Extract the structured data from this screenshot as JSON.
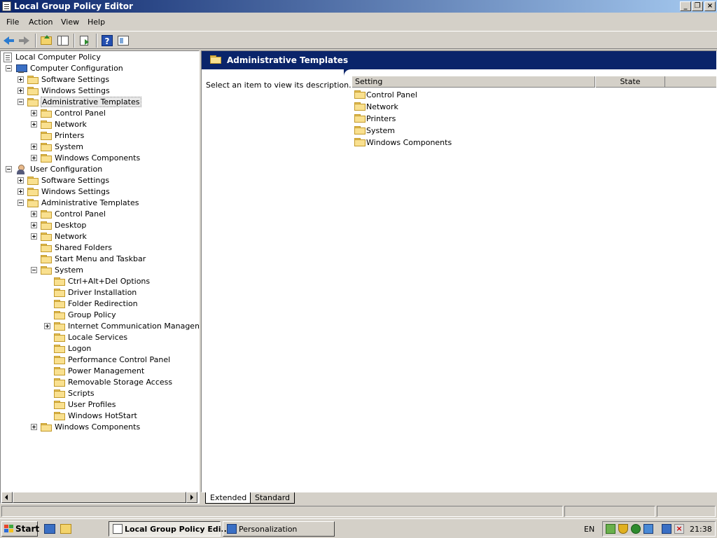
{
  "window": {
    "title": "Local Group Policy Editor"
  },
  "menu": [
    "File",
    "Action",
    "View",
    "Help"
  ],
  "tree": [
    {
      "label": "Local Computer Policy",
      "level": 0,
      "icon": "document-icon",
      "expander": "none"
    },
    {
      "label": "Computer Configuration",
      "level": 0,
      "icon": "computer-icon",
      "expander": "minus"
    },
    {
      "label": "Software Settings",
      "level": 1,
      "icon": "folder-icon",
      "expander": "plus"
    },
    {
      "label": "Windows Settings",
      "level": 1,
      "icon": "folder-icon",
      "expander": "plus"
    },
    {
      "label": "Administrative Templates",
      "level": 1,
      "icon": "folder-icon",
      "expander": "minus",
      "selected": true
    },
    {
      "label": "Control Panel",
      "level": 2,
      "icon": "folder-icon",
      "expander": "plus"
    },
    {
      "label": "Network",
      "level": 2,
      "icon": "folder-icon",
      "expander": "plus"
    },
    {
      "label": "Printers",
      "level": 2,
      "icon": "folder-icon",
      "expander": "none"
    },
    {
      "label": "System",
      "level": 2,
      "icon": "folder-icon",
      "expander": "plus"
    },
    {
      "label": "Windows Components",
      "level": 2,
      "icon": "folder-icon",
      "expander": "plus"
    },
    {
      "label": "User Configuration",
      "level": 0,
      "icon": "user-icon",
      "expander": "minus"
    },
    {
      "label": "Software Settings",
      "level": 1,
      "icon": "folder-icon",
      "expander": "plus"
    },
    {
      "label": "Windows Settings",
      "level": 1,
      "icon": "folder-icon",
      "expander": "plus"
    },
    {
      "label": "Administrative Templates",
      "level": 1,
      "icon": "folder-icon",
      "expander": "minus"
    },
    {
      "label": "Control Panel",
      "level": 2,
      "icon": "folder-icon",
      "expander": "plus"
    },
    {
      "label": "Desktop",
      "level": 2,
      "icon": "folder-icon",
      "expander": "plus"
    },
    {
      "label": "Network",
      "level": 2,
      "icon": "folder-icon",
      "expander": "plus"
    },
    {
      "label": "Shared Folders",
      "level": 2,
      "icon": "folder-icon",
      "expander": "none"
    },
    {
      "label": "Start Menu and Taskbar",
      "level": 2,
      "icon": "folder-icon",
      "expander": "none"
    },
    {
      "label": "System",
      "level": 2,
      "icon": "folder-icon",
      "expander": "minus"
    },
    {
      "label": "Ctrl+Alt+Del Options",
      "level": 3,
      "icon": "folder-icon",
      "expander": "none"
    },
    {
      "label": "Driver Installation",
      "level": 3,
      "icon": "folder-icon",
      "expander": "none"
    },
    {
      "label": "Folder Redirection",
      "level": 3,
      "icon": "folder-icon",
      "expander": "none"
    },
    {
      "label": "Group Policy",
      "level": 3,
      "icon": "folder-icon",
      "expander": "none"
    },
    {
      "label": "Internet Communication Management",
      "level": 3,
      "icon": "folder-icon",
      "expander": "plus"
    },
    {
      "label": "Locale Services",
      "level": 3,
      "icon": "folder-icon",
      "expander": "none"
    },
    {
      "label": "Logon",
      "level": 3,
      "icon": "folder-icon",
      "expander": "none"
    },
    {
      "label": "Performance Control Panel",
      "level": 3,
      "icon": "folder-icon",
      "expander": "none"
    },
    {
      "label": "Power Management",
      "level": 3,
      "icon": "folder-icon",
      "expander": "none"
    },
    {
      "label": "Removable Storage Access",
      "level": 3,
      "icon": "folder-icon",
      "expander": "none"
    },
    {
      "label": "Scripts",
      "level": 3,
      "icon": "folder-icon",
      "expander": "none"
    },
    {
      "label": "User Profiles",
      "level": 3,
      "icon": "folder-icon",
      "expander": "none"
    },
    {
      "label": "Windows HotStart",
      "level": 3,
      "icon": "folder-icon",
      "expander": "none"
    },
    {
      "label": "Windows Components",
      "level": 2,
      "icon": "folder-icon",
      "expander": "plus"
    }
  ],
  "details": {
    "header_title": "Administrative Templates",
    "description": "Select an item to view its description.",
    "columns": [
      "Setting",
      "State"
    ],
    "items": [
      "Control Panel",
      "Network",
      "Printers",
      "System",
      "Windows Components"
    ]
  },
  "tabs": {
    "extended": "Extended",
    "standard": "Standard"
  },
  "taskbar": {
    "start_label": "Start",
    "tasks": [
      {
        "label": "Local Group Policy Edi...",
        "active": true
      },
      {
        "label": "Personalization",
        "active": false
      }
    ],
    "language": "EN",
    "clock": "21:38"
  },
  "colors": {
    "title_bar": "#0a246a",
    "selection": "#e8e8e8",
    "folder": "#f9e08f"
  }
}
